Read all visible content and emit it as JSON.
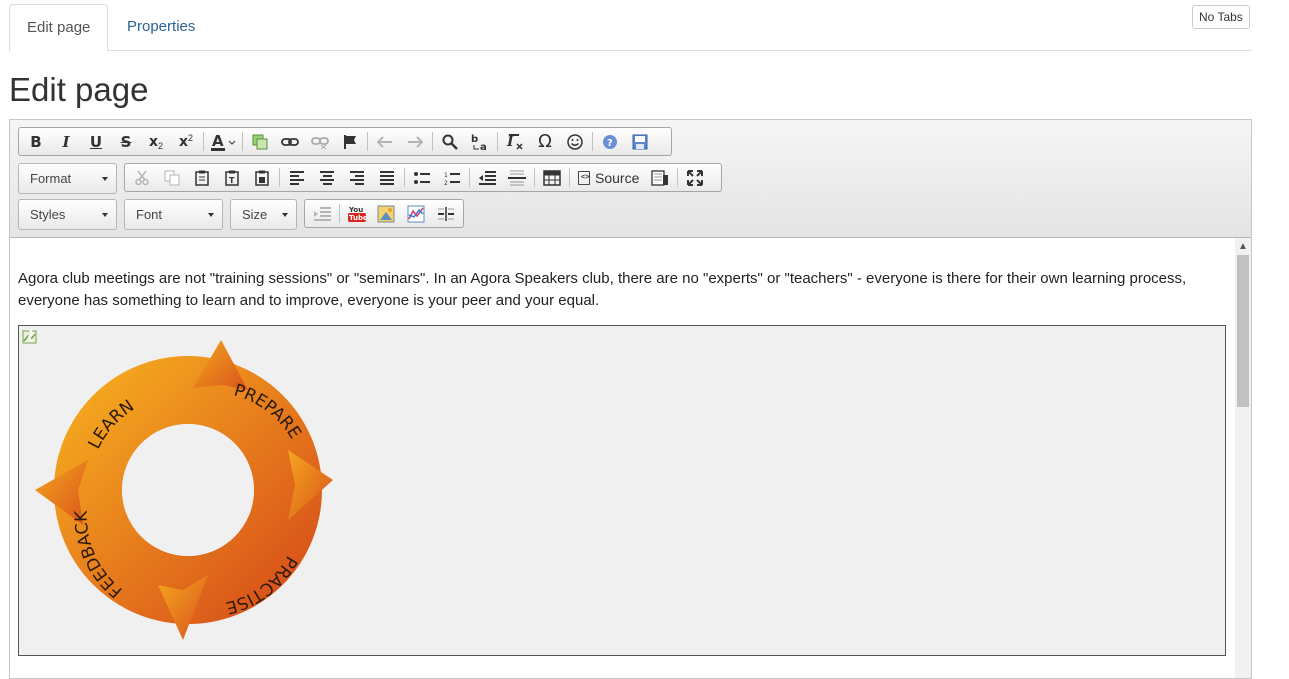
{
  "tabs": [
    {
      "label": "Edit page",
      "active": true
    },
    {
      "label": "Properties",
      "active": false
    }
  ],
  "no_tabs_label": "No Tabs",
  "page_title": "Edit page",
  "toolbar": {
    "format_label": "Format",
    "styles_label": "Styles",
    "font_label": "Font",
    "size_label": "Size",
    "source_label": "Source"
  },
  "content": {
    "paragraph": "Agora club meetings are not \"training sessions\" or \"seminars\".  In an Agora Speakers club, there are no \"experts\" or \"teachers\" - everyone is there for their own learning process, everyone has something to learn and to improve, everyone is your peer and your equal.",
    "cycle_labels": [
      "LEARN",
      "PREPARE",
      "PRACTISE",
      "FEEDBACK"
    ]
  },
  "colors": {
    "arrow_light": "#f2a31f",
    "arrow_dark": "#d9571a",
    "tab_link": "#2a6496"
  }
}
